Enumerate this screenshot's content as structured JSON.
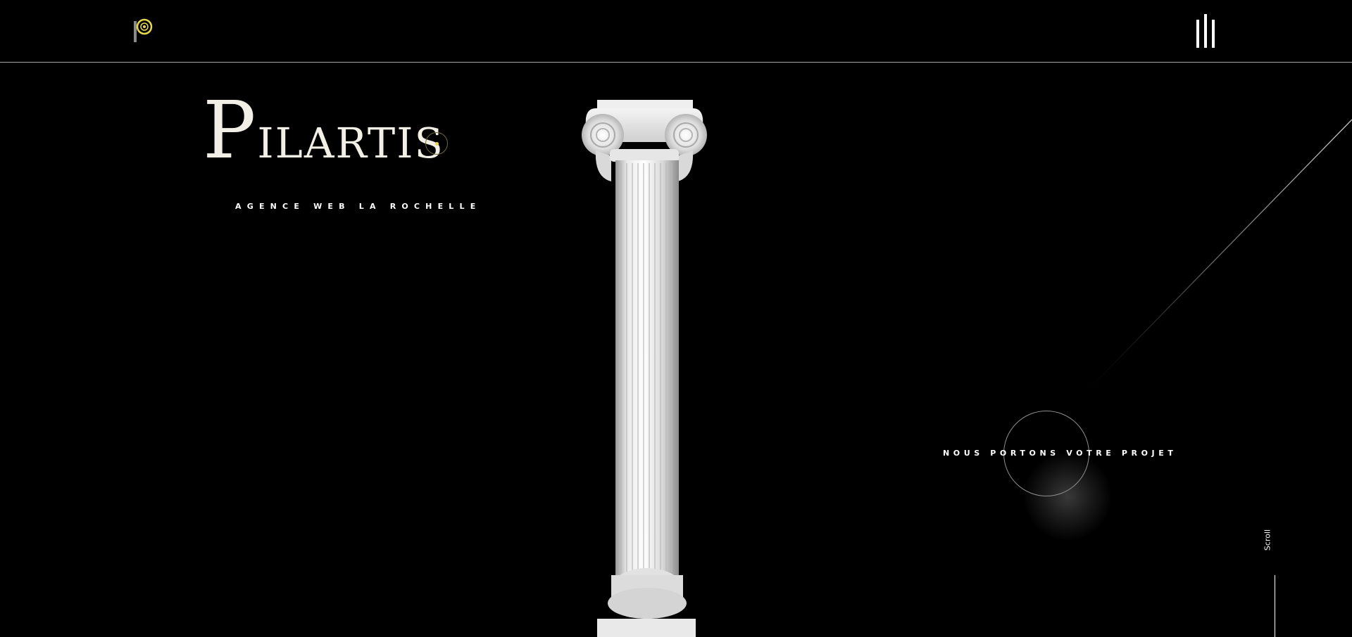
{
  "header": {
    "logo_icon": "pilartis-p-logo-icon",
    "menu_icon": "hamburger-bars-icon"
  },
  "hero": {
    "title_first": "P",
    "title_rest": "ilartis",
    "tagline": "AGENCE WEB LA ROCHELLE",
    "image": "ionic-column-3d"
  },
  "cta": {
    "label": "NOUS PORTONS VOTRE PROJET"
  },
  "scroll": {
    "label": "Scroll"
  },
  "colors": {
    "background": "#000000",
    "title": "#f2efe6",
    "accent_yellow": "#e8d84a",
    "divider": "#a9a9a9"
  }
}
